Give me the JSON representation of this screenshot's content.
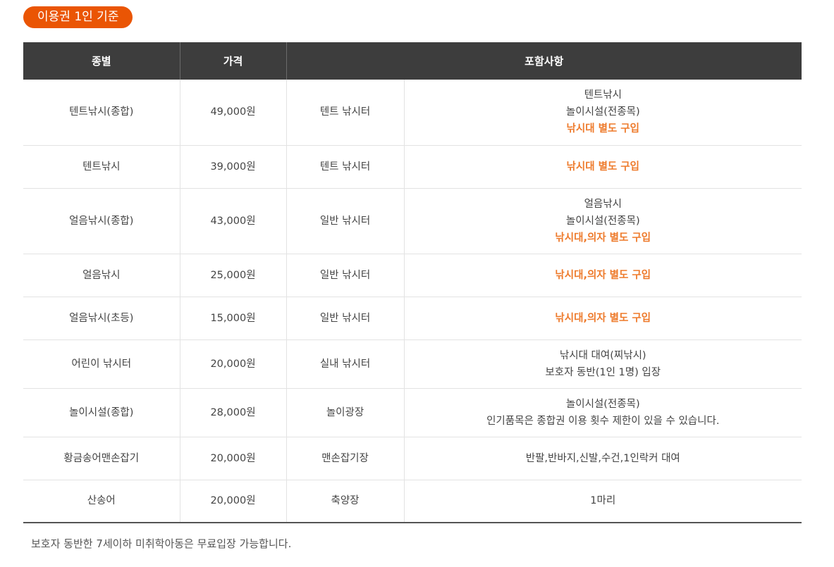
{
  "badge": "이용권 1인 기준",
  "headers": {
    "type": "종별",
    "price": "가격",
    "includes": "포함사항"
  },
  "rows": [
    {
      "type": "텐트낚시(종합)",
      "price": "49,000원",
      "place": "텐트 낚시터",
      "lines": [
        "텐트낚시",
        "놀이시설(전종목)"
      ],
      "highlight": "낚시대 별도 구입"
    },
    {
      "type": "텐트낚시",
      "price": "39,000원",
      "place": "텐트 낚시터",
      "lines": [],
      "highlight": "낚시대 별도 구입"
    },
    {
      "type": "얼음낚시(종합)",
      "price": "43,000원",
      "place": "일반 낚시터",
      "lines": [
        "얼음낚시",
        "놀이시설(전종목)"
      ],
      "highlight": "낚시대,의자 별도 구입"
    },
    {
      "type": "얼음낚시",
      "price": "25,000원",
      "place": "일반 낚시터",
      "lines": [],
      "highlight": "낚시대,의자 별도 구입"
    },
    {
      "type": "얼음낚시(초등)",
      "price": "15,000원",
      "place": "일반 낚시터",
      "lines": [],
      "highlight": "낚시대,의자 별도 구입"
    },
    {
      "type": "어린이 낚시터",
      "price": "20,000원",
      "place": "실내 낚시터",
      "lines": [
        "낚시대 대여(찌낚시)",
        "보호자 동반(1인 1명) 입장"
      ],
      "highlight": ""
    },
    {
      "type": "놀이시설(종합)",
      "price": "28,000원",
      "place": "놀이광장",
      "lines": [
        "놀이시설(전종목)",
        "인기품목은 종합권 이용 횟수 제한이 있을 수 있습니다."
      ],
      "highlight": ""
    },
    {
      "type": "황금송어맨손잡기",
      "price": "20,000원",
      "place": "맨손잡기장",
      "lines": [
        "반팔,반바지,신발,수건,1인락커 대여"
      ],
      "highlight": ""
    },
    {
      "type": "산송어",
      "price": "20,000원",
      "place": "축양장",
      "lines": [
        "1마리"
      ],
      "highlight": ""
    }
  ],
  "note": "보호자 동반한 7세이하 미취학아동은 무료입장 가능합니다.",
  "colors": {
    "badge": "#ea5504",
    "header_bg": "#3d3d3d",
    "highlight": "#ee7a2b"
  }
}
